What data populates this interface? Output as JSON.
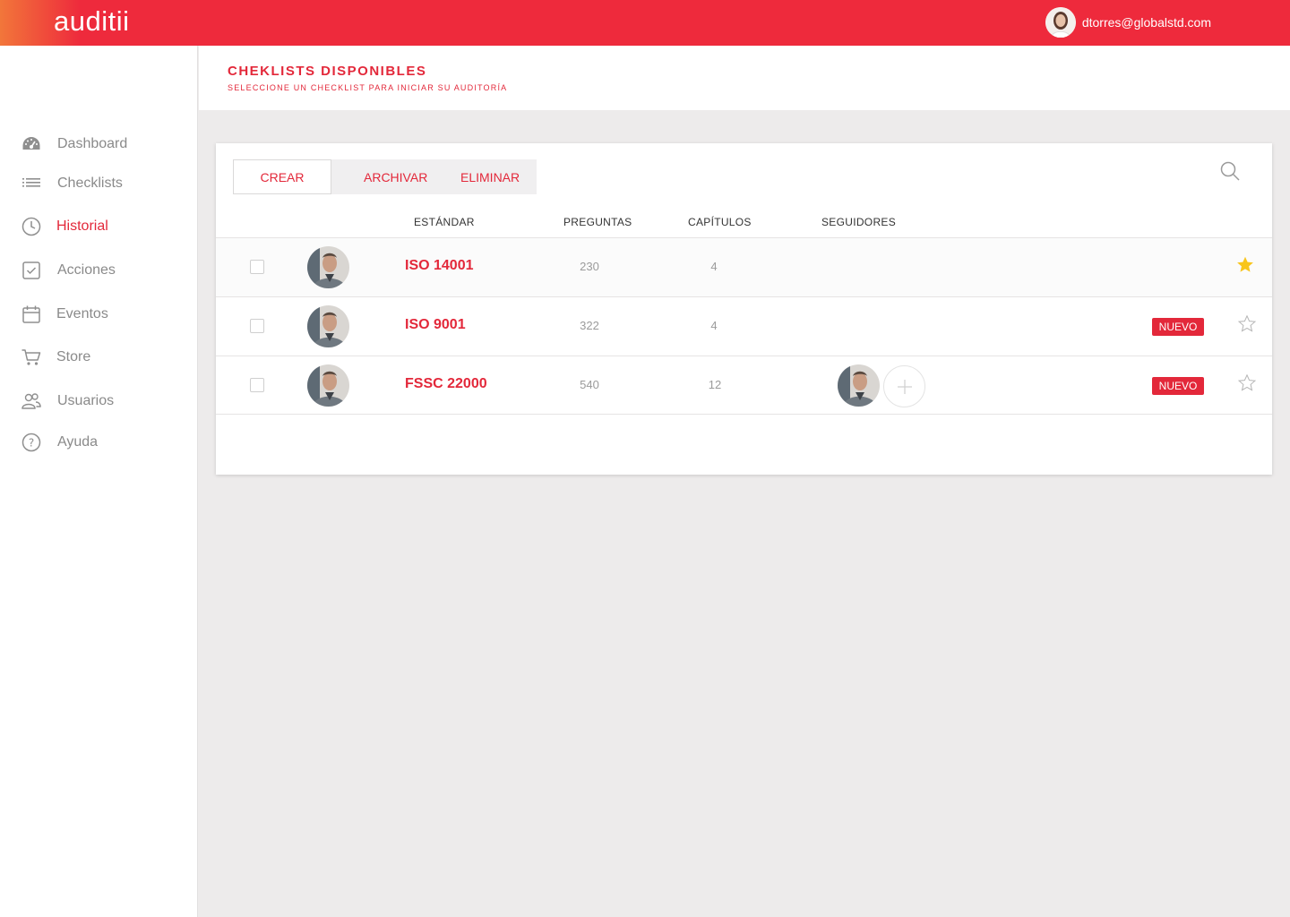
{
  "app": {
    "logo": "auditii"
  },
  "user": {
    "email": "dtorres@globalstd.com"
  },
  "sidebar": {
    "items": [
      {
        "label": "Dashboard",
        "icon": "dashboard-icon"
      },
      {
        "label": "Checklists",
        "icon": "list-icon"
      },
      {
        "label": "Historial",
        "icon": "clock-icon",
        "active": true
      },
      {
        "label": "Acciones",
        "icon": "checkbox-icon"
      },
      {
        "label": "Eventos",
        "icon": "calendar-icon"
      },
      {
        "label": "Store",
        "icon": "cart-icon"
      },
      {
        "label": "Usuarios",
        "icon": "users-icon"
      },
      {
        "label": "Ayuda",
        "icon": "help-icon"
      }
    ]
  },
  "header": {
    "title": "CHEKLISTS DISPONIBLES",
    "subtitle": "SELECCIONE UN CHECKLIST PARA INICIAR SU AUDITORÍA"
  },
  "toolbar": {
    "crear": "CREAR",
    "archivar": "ARCHIVAR",
    "eliminar": "ELIMINAR"
  },
  "table": {
    "headers": {
      "estandar": "ESTÁNDAR",
      "preguntas": "PREGUNTAS",
      "capitulos": "CAPÍTULOS",
      "seguidores": "SEGUIDORES"
    },
    "rows": [
      {
        "name": "ISO 14001",
        "preguntas": "230",
        "capitulos": "4",
        "badge": "",
        "starred": true,
        "followers": 0
      },
      {
        "name": "ISO 9001",
        "preguntas": "322",
        "capitulos": "4",
        "badge": "NUEVO",
        "starred": false,
        "followers": 0
      },
      {
        "name": "FSSC 22000",
        "preguntas": "540",
        "capitulos": "12",
        "badge": "NUEVO",
        "starred": false,
        "followers": 1
      }
    ]
  },
  "colors": {
    "brand": "#ee2a3c",
    "accent": "#e3283a",
    "star": "#f8c51c",
    "background": "#edebeb"
  }
}
